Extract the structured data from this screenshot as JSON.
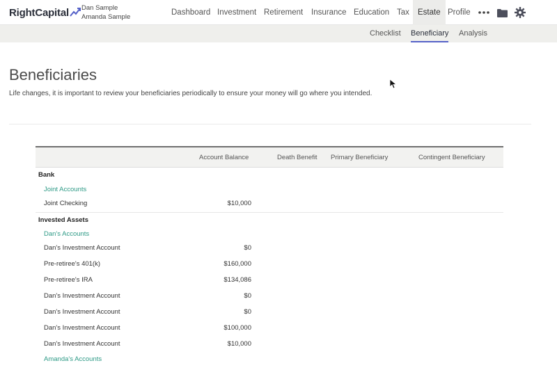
{
  "brand": {
    "name": "RightCapital"
  },
  "users": [
    "Dan Sample",
    "Amanda Sample"
  ],
  "nav": {
    "items": [
      "Dashboard",
      "Investment",
      "Retirement",
      "Insurance",
      "Education",
      "Tax",
      "Estate",
      "Profile"
    ],
    "active": "Estate",
    "more_icon": "more-dots-icon",
    "folder_icon": "folder-icon",
    "settings_icon": "gear-icon"
  },
  "subnav": {
    "tabs": [
      "Checklist",
      "Beneficiary",
      "Analysis"
    ],
    "active": "Beneficiary",
    "accent": "#5561c8"
  },
  "page": {
    "title": "Beneficiaries",
    "subtitle": "Life changes, it is important to review your beneficiaries periodically to ensure your money will go where you intended."
  },
  "table": {
    "columns": [
      "Account Balance",
      "Death Benefit",
      "Primary Beneficiary",
      "Contingent Beneficiary"
    ],
    "groups": [
      {
        "name": "Bank",
        "sections": [
          {
            "owner": "Joint Accounts",
            "accounts": [
              {
                "name": "Joint Checking",
                "balance": "$10,000"
              }
            ]
          }
        ]
      },
      {
        "name": "Invested Assets",
        "sections": [
          {
            "owner": "Dan's Accounts",
            "accounts": [
              {
                "name": "Dan's Investment Account",
                "balance": "$0"
              },
              {
                "name": "Pre-retiree's 401(k)",
                "balance": "$160,000"
              },
              {
                "name": "Pre-retiree's IRA",
                "balance": "$134,086"
              },
              {
                "name": "Dan's Investment Account",
                "balance": "$0"
              },
              {
                "name": "Dan's Investment Account",
                "balance": "$0"
              },
              {
                "name": "Dan's Investment Account",
                "balance": "$100,000"
              },
              {
                "name": "Dan's Investment Account",
                "balance": "$10,000"
              }
            ]
          },
          {
            "owner": "Amanda's Accounts",
            "accounts": []
          }
        ]
      }
    ],
    "owner_color": "#2e9a86"
  }
}
